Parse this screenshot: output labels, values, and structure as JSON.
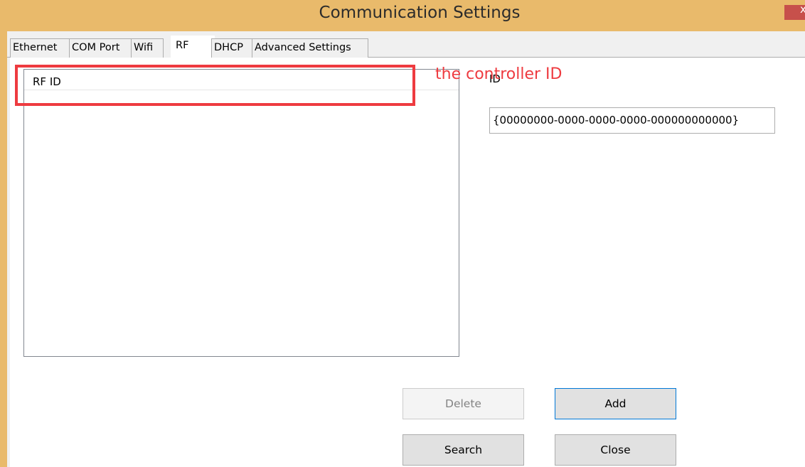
{
  "window": {
    "title": "Communication Settings",
    "close_glyph": "x"
  },
  "tabs": [
    {
      "label": "Ethernet"
    },
    {
      "label": "COM Port"
    },
    {
      "label": "Wifi"
    },
    {
      "label": "RF",
      "selected": true
    },
    {
      "label": "DHCP"
    },
    {
      "label": "Advanced Settings"
    }
  ],
  "rf_list": {
    "column_header": "RF  ID",
    "rows": []
  },
  "annotation": {
    "text": "the controller ID",
    "color": "#ee3b40"
  },
  "id_field": {
    "label": "ID",
    "value": "{00000000-0000-0000-0000-000000000000}"
  },
  "buttons": {
    "delete": "Delete",
    "add": "Add",
    "search": "Search",
    "close": "Close"
  },
  "colors": {
    "title_bar": "#e9ba6b",
    "close_button": "#c7504b",
    "accent": "#0078d7"
  }
}
